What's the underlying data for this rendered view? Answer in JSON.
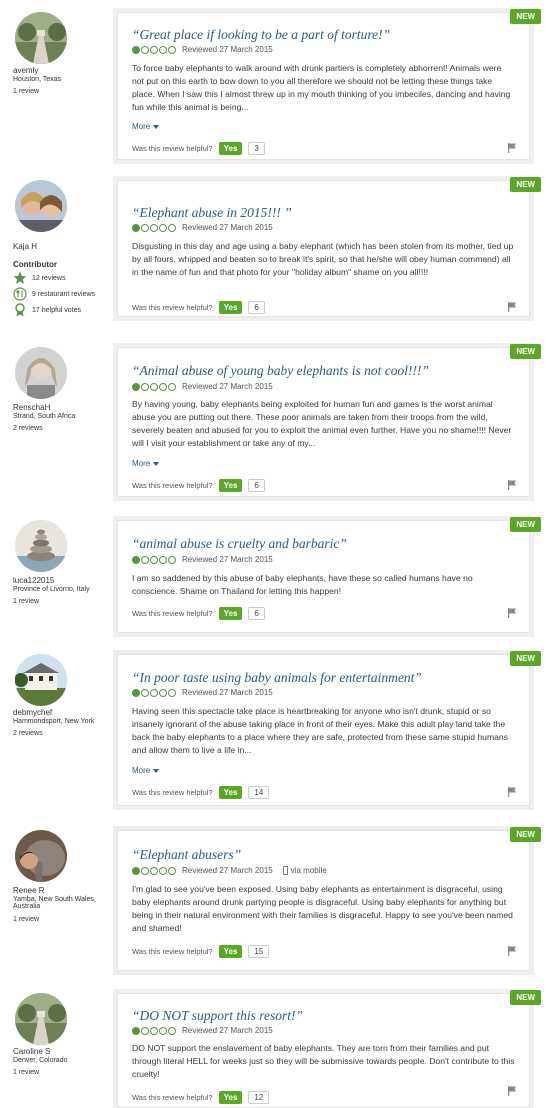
{
  "reviews": [
    {
      "username": "avemly",
      "location": "Houston, Texas",
      "reviews_count": "1 review",
      "title": "“Great place if looking to be a part of torture!”",
      "rating": 1,
      "date": "Reviewed 27 March 2015",
      "text": "To force baby elephants to walk around with drunk partiers is completely abhorrent! Animals were not put on this earth to bow down to you all therefore we should not be letting these things take place. When I saw this I almost threw up in my mouth thinking of you imbeciles, dancing and having fun while this animal is being...",
      "more": "More",
      "helpful_q": "Was this review helpful?",
      "yes": "Yes",
      "count": "3",
      "badge": "NEW"
    },
    {
      "username": "Kaja H",
      "badge_title": "Contributor",
      "stats": [
        "12 reviews",
        "9 restaurant reviews",
        "17 helpful votes"
      ],
      "title": "“Elephant abuse in 2015!!! ”",
      "rating": 1,
      "date": "Reviewed 27 March 2015",
      "text": "Disgusting in this day and age using a baby elephant (which has been stolen from its mother, tied up by all fours, whipped and beaten so to break it's spirit, so that he/she will obey human command) all in the name of fun and that photo for your \"holiday album\" shame on you all!!!!",
      "helpful_q": "Was this review helpful?",
      "yes": "Yes",
      "count": "6",
      "badge": "NEW"
    },
    {
      "username": "RenschaH",
      "location": "Strand, South Africa",
      "reviews_count": "2 reviews",
      "title": "“Animal abuse of young baby elephants is not cool!!!”",
      "rating": 1,
      "date": "Reviewed 27 March 2015",
      "text": "By having young, baby elephants being exploited for human fun and games is the worst animal abuse you are putting out there. These poor animals are taken from their troops from the wild, severely beaten and abused for you to exploit the animal even further. Have you no shame!!!! Never will I visit your establishment or take any of my...",
      "more": "More",
      "helpful_q": "Was this review helpful?",
      "yes": "Yes",
      "count": "6",
      "badge": "NEW"
    },
    {
      "username": "luca122015",
      "location": "Province of Livorno, Italy",
      "reviews_count": "1 review",
      "title": "“animal abuse is cruelty and barbaric”",
      "rating": 1,
      "date": "Reviewed 27 March 2015",
      "text": "I am so saddened by this abuse of baby elephants, have these so called humans have no conscience. Shame on Thailand for letting this happen!",
      "helpful_q": "Was this review helpful?",
      "yes": "Yes",
      "count": "6",
      "badge": "NEW"
    },
    {
      "username": "debmychef",
      "location": "Hammondsport, New York",
      "reviews_count": "2 reviews",
      "title": "“In poor taste using baby animals for entertainment”",
      "rating": 1,
      "date": "Reviewed 27 March 2015",
      "text": "Having seen this spectacle take place is heartbreaking for anyone who isn't drunk, stupid or so insanely ignorant of the abuse taking place in front of their eyes. Make this adult play land take the back the baby elephants to a place where they are safe, protected from these same stupid humans and allow them to live a life in...",
      "more": "More",
      "helpful_q": "Was this review helpful?",
      "yes": "Yes",
      "count": "14",
      "badge": "NEW"
    },
    {
      "username": "Renee R",
      "location": "Yamba, New South Wales, Australia",
      "reviews_count": "1 review",
      "title": "“Elephant abusers”",
      "rating": 1,
      "date": "Reviewed 27 March 2015",
      "via": "via mobile",
      "text": "I'm glad to see you've been exposed. Using baby elephants as entertainment is disgraceful, using baby elephants around drunk partying people is disgraceful. Using baby elephants for anything but being in their natural environment with their families is disgraceful. Happy to see you've been named and shamed!",
      "helpful_q": "Was this review helpful?",
      "yes": "Yes",
      "count": "15",
      "badge": "NEW"
    },
    {
      "username": "Caroline S",
      "location": "Denver, Colorado",
      "reviews_count": "1 review",
      "title": "“DO NOT support this resort!”",
      "rating": 1,
      "date": "Reviewed 27 March 2015",
      "text": "DO NOT support the enslavement of baby elephants. They are torn from their families and put through literal HELL for weeks just so they will be submissive towards people. Don't contribute to this cruelty!",
      "helpful_q": "Was this review helpful?",
      "yes": "Yes",
      "count": "12",
      "badge": "NEW"
    }
  ]
}
